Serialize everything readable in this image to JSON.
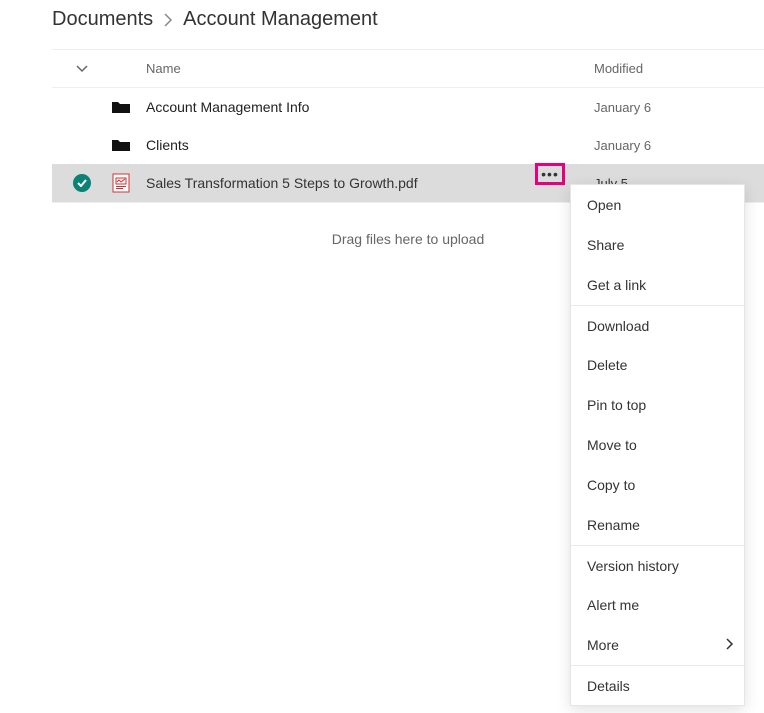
{
  "breadcrumb": {
    "root": "Documents",
    "current": "Account Management"
  },
  "columns": {
    "name": "Name",
    "modified": "Modified"
  },
  "rows": [
    {
      "type": "folder",
      "name": "Account Management Info",
      "modified": "January 6",
      "selected": false
    },
    {
      "type": "folder",
      "name": "Clients",
      "modified": "January 6",
      "selected": false
    },
    {
      "type": "pdf",
      "name": "Sales Transformation 5 Steps to Growth.pdf",
      "modified": "July 5",
      "selected": true
    }
  ],
  "dragHint": "Drag files here to upload",
  "menu": {
    "items": [
      {
        "label": "Open",
        "sep": false,
        "sub": false
      },
      {
        "label": "Share",
        "sep": false,
        "sub": false
      },
      {
        "label": "Get a link",
        "sep": false,
        "sub": false
      },
      {
        "label": "Download",
        "sep": true,
        "sub": false
      },
      {
        "label": "Delete",
        "sep": false,
        "sub": false
      },
      {
        "label": "Pin to top",
        "sep": false,
        "sub": false
      },
      {
        "label": "Move to",
        "sep": false,
        "sub": false
      },
      {
        "label": "Copy to",
        "sep": false,
        "sub": false
      },
      {
        "label": "Rename",
        "sep": false,
        "sub": false
      },
      {
        "label": "Version history",
        "sep": true,
        "sub": false
      },
      {
        "label": "Alert me",
        "sep": false,
        "sub": false
      },
      {
        "label": "More",
        "sep": false,
        "sub": true
      },
      {
        "label": "Details",
        "sep": true,
        "sub": false
      }
    ]
  }
}
